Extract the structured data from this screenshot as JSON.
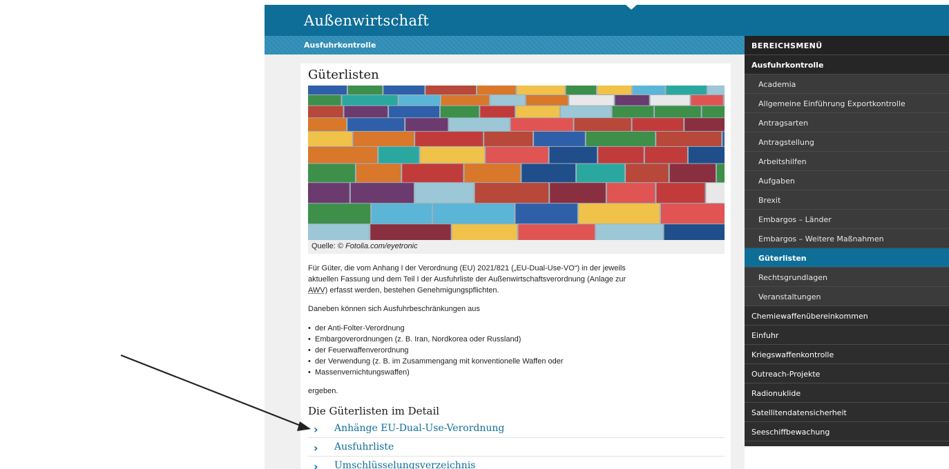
{
  "header": {
    "site_title": "Außenwirtschaft"
  },
  "subbar": {
    "breadcrumb": "Ausfuhrkontrolle"
  },
  "main": {
    "page_title": "Güterlisten",
    "caption_prefix": "Quelle: © ",
    "caption_source": "Fotolia.com/eyetronic",
    "intro_line1": "Für Güter, die vom Anhang I der Verordnung (EU) 2021/821 („EU-Dual-Use-VO“) in der jeweils",
    "intro_line2": "aktuellen Fassung und dem Teil I der Ausfuhrliste der Außenwirtschaftsverordnung (Anlage zur",
    "intro_line3_abbr": "AWV",
    "intro_line3_rest": ") erfasst werden, bestehen Genehmigungspflichten.",
    "para2": "Daneben können sich Ausfuhrbeschränkungen aus",
    "bullets": [
      "der Anti-Folter-Verordnung",
      "Embargoverordnungen (z. B. Iran, Nordkorea oder Russland)",
      "der Feuerwaffenverordnung",
      "der Verwendung (z. B. im Zusammengang mit konventionelle Waffen oder",
      "Massenvernichtungswaffen)"
    ],
    "para3": "ergeben.",
    "section_heading": "Die Güterlisten im Detail",
    "links": [
      "Anhänge EU-Dual-Use-Verordnung",
      "Ausfuhrliste",
      "Umschlüsselungsverzeichnis"
    ]
  },
  "sidemenu": {
    "header": "BEREICHSMENÜ",
    "section": "Ausfuhrkontrolle",
    "sub_items": [
      "Academia",
      "Allgemeine Einführung Exportkontrolle",
      "Antragsarten",
      "Antragstellung",
      "Arbeitshilfen",
      "Aufgaben",
      "Brexit",
      "Embargos – Länder",
      "Embargos – Weitere Maßnahmen",
      "Güterlisten",
      "Rechtsgrundlagen",
      "Veranstaltungen"
    ],
    "top_items": [
      "Chemiewaffenübereinkommen",
      "Einfuhr",
      "Kriegswaffenkontrolle",
      "Outreach-Projekte",
      "Radionuklide",
      "Satellitendatensicherheit",
      "Seeschiffbewachung"
    ]
  },
  "colors": {
    "brand": "#0f6e97",
    "menu_bg": "#2d2d2d",
    "active": "#0f6e97"
  }
}
